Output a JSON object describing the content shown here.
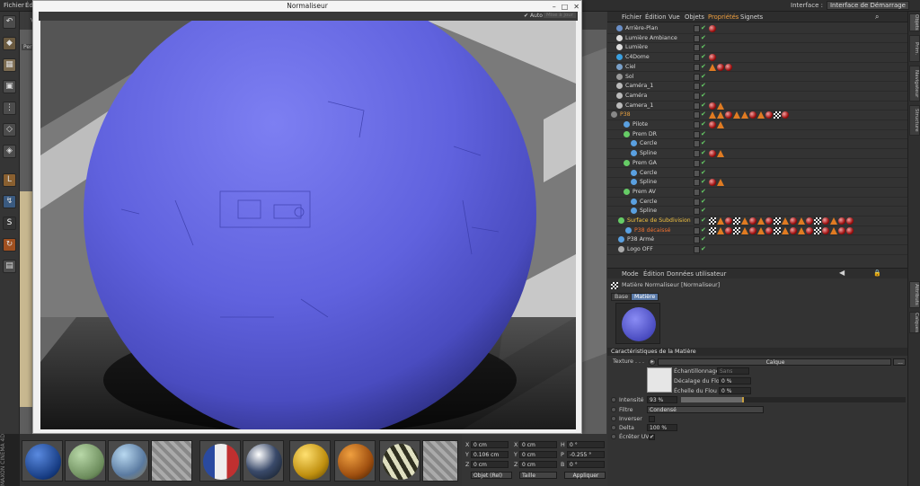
{
  "topmenu": {
    "items": [
      "Fichier",
      "Éditi"
    ],
    "interface_label": "Interface :",
    "interface_value": "Interface de Démarrage"
  },
  "viewport": {
    "tab": "Vi",
    "persp": "Perspe"
  },
  "dialog": {
    "title": "Normaliseur",
    "auto_label": "Auto",
    "refresh_label": "Mise à jour"
  },
  "objects": {
    "menu": [
      "Fichier",
      "Édition",
      "Vue",
      "Objets",
      "Propriétés",
      "Signets"
    ],
    "rows": [
      {
        "name": "Arrière-Plan",
        "indent": 10,
        "icon": "#6a8fc8",
        "color": "#d6d6d6"
      },
      {
        "name": "Lumière Ambiance",
        "indent": 10,
        "icon": "#ddd",
        "color": "#d6d6d6"
      },
      {
        "name": "Lumière",
        "indent": 10,
        "icon": "#ddd",
        "color": "#d6d6d6"
      },
      {
        "name": "C4Dome",
        "indent": 10,
        "icon": "#3aa0e0",
        "color": "#d6d6d6"
      },
      {
        "name": "Ciel",
        "indent": 10,
        "icon": "#7aa0c8",
        "color": "#d6d6d6"
      },
      {
        "name": "Sol",
        "indent": 10,
        "icon": "#9a9a9a",
        "color": "#d6d6d6"
      },
      {
        "name": "Caméra_1",
        "indent": 10,
        "icon": "#bbb",
        "color": "#d6d6d6"
      },
      {
        "name": "Caméra",
        "indent": 10,
        "icon": "#bbb",
        "color": "#d6d6d6"
      },
      {
        "name": "Camera_1",
        "indent": 10,
        "icon": "#bbb",
        "color": "#d6d6d6"
      },
      {
        "name": "P38",
        "indent": 4,
        "icon": "#888",
        "color": "#e6a040"
      },
      {
        "name": "Pilote",
        "indent": 18,
        "icon": "#5aa0e0",
        "color": "#d6d6d6"
      },
      {
        "name": "Prem DR",
        "indent": 18,
        "icon": "#66cc66",
        "color": "#d6d6d6"
      },
      {
        "name": "Cercle",
        "indent": 26,
        "icon": "#5aa0e0",
        "color": "#d6d6d6"
      },
      {
        "name": "Spline",
        "indent": 26,
        "icon": "#5aa0e0",
        "color": "#d6d6d6"
      },
      {
        "name": "Prem GA",
        "indent": 18,
        "icon": "#66cc66",
        "color": "#d6d6d6"
      },
      {
        "name": "Cercle",
        "indent": 26,
        "icon": "#5aa0e0",
        "color": "#d6d6d6"
      },
      {
        "name": "Spline",
        "indent": 26,
        "icon": "#5aa0e0",
        "color": "#d6d6d6"
      },
      {
        "name": "Prem AV",
        "indent": 18,
        "icon": "#66cc66",
        "color": "#d6d6d6"
      },
      {
        "name": "Cercle",
        "indent": 26,
        "icon": "#5aa0e0",
        "color": "#d6d6d6"
      },
      {
        "name": "Spline",
        "indent": 26,
        "icon": "#5aa0e0",
        "color": "#d6d6d6"
      },
      {
        "name": "Surface de Subdivision",
        "indent": 12,
        "icon": "#66cc66",
        "color": "#f0c040"
      },
      {
        "name": "P38 décaissé",
        "indent": 20,
        "icon": "#5aa0e0",
        "color": "#f07030"
      },
      {
        "name": "P38 Armé",
        "indent": 12,
        "icon": "#5aa0e0",
        "color": "#d6d6d6"
      },
      {
        "name": "Logo OFF",
        "indent": 12,
        "icon": "#aaa",
        "color": "#d6d6d6"
      }
    ]
  },
  "attributes": {
    "menu": [
      "Mode",
      "Édition",
      "Données utilisateur"
    ],
    "title": "Matière Normaliseur [Normaliseur]",
    "tabs": [
      "Base",
      "Matière"
    ],
    "section": "Caractéristiques de la Matière",
    "texture_label": "Texture . . .",
    "texture_value": "Calque",
    "sampling_label": "Échantillonnage",
    "sampling_value": "Sans",
    "blur_offset_label": "Décalage du Flou",
    "blur_offset_value": "0 %",
    "blur_scale_label": "Échelle du Flou",
    "blur_scale_value": "0 %",
    "intensity_label": "Intensité",
    "intensity_value": "93 %",
    "intensity_pct": 93,
    "filter_label": "Filtre",
    "filter_value": "Condensé",
    "invert_label": "Inverser",
    "delta_label": "Delta",
    "delta_value": "100 %",
    "uv_label": "Écrêter UV"
  },
  "coords": {
    "x_pos": "0 cm",
    "y_pos": "0.106 cm",
    "z_pos": "0 cm",
    "x_size": "0 cm",
    "y_size": "0 cm",
    "z_size": "0 cm",
    "h": "0 °",
    "p": "-0.255 °",
    "b": "0 °",
    "mode": "Objet (Rel)",
    "size_mode": "Taille",
    "apply": "Appliquer"
  },
  "side_tabs": [
    "Objets",
    "Prim.",
    "Navigateur",
    "Structure"
  ],
  "attr_side_tabs": [
    "Attributs",
    "Calques"
  ],
  "brand": "MAXON CINEMA 4D"
}
